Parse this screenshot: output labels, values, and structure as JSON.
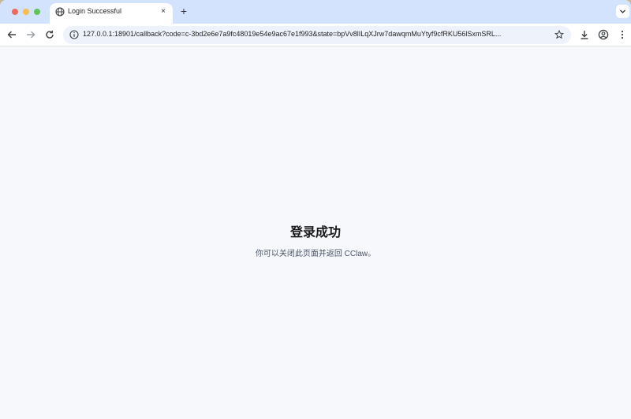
{
  "browser": {
    "tab_title": "Login Successful",
    "tab_close": "×",
    "new_tab": "+",
    "url": "127.0.0.1:18901/callback?code=c-3bd2e6e7a9fc48019e54e9ac67e1f993&state=bpVv8lILqXJrw7dawqmMuYtyf9cfRKU56lSxmSRL...",
    "icons": [
      "back-arrow-icon",
      "forward-arrow-icon",
      "reload-icon",
      "info-icon",
      "star-icon",
      "download-icon",
      "profile-icon",
      "menu-icon",
      "globe-icon",
      "tab-search-icon"
    ]
  },
  "page": {
    "heading": "登录成功",
    "message": "你可以关闭此页面并返回 CClaw。"
  }
}
